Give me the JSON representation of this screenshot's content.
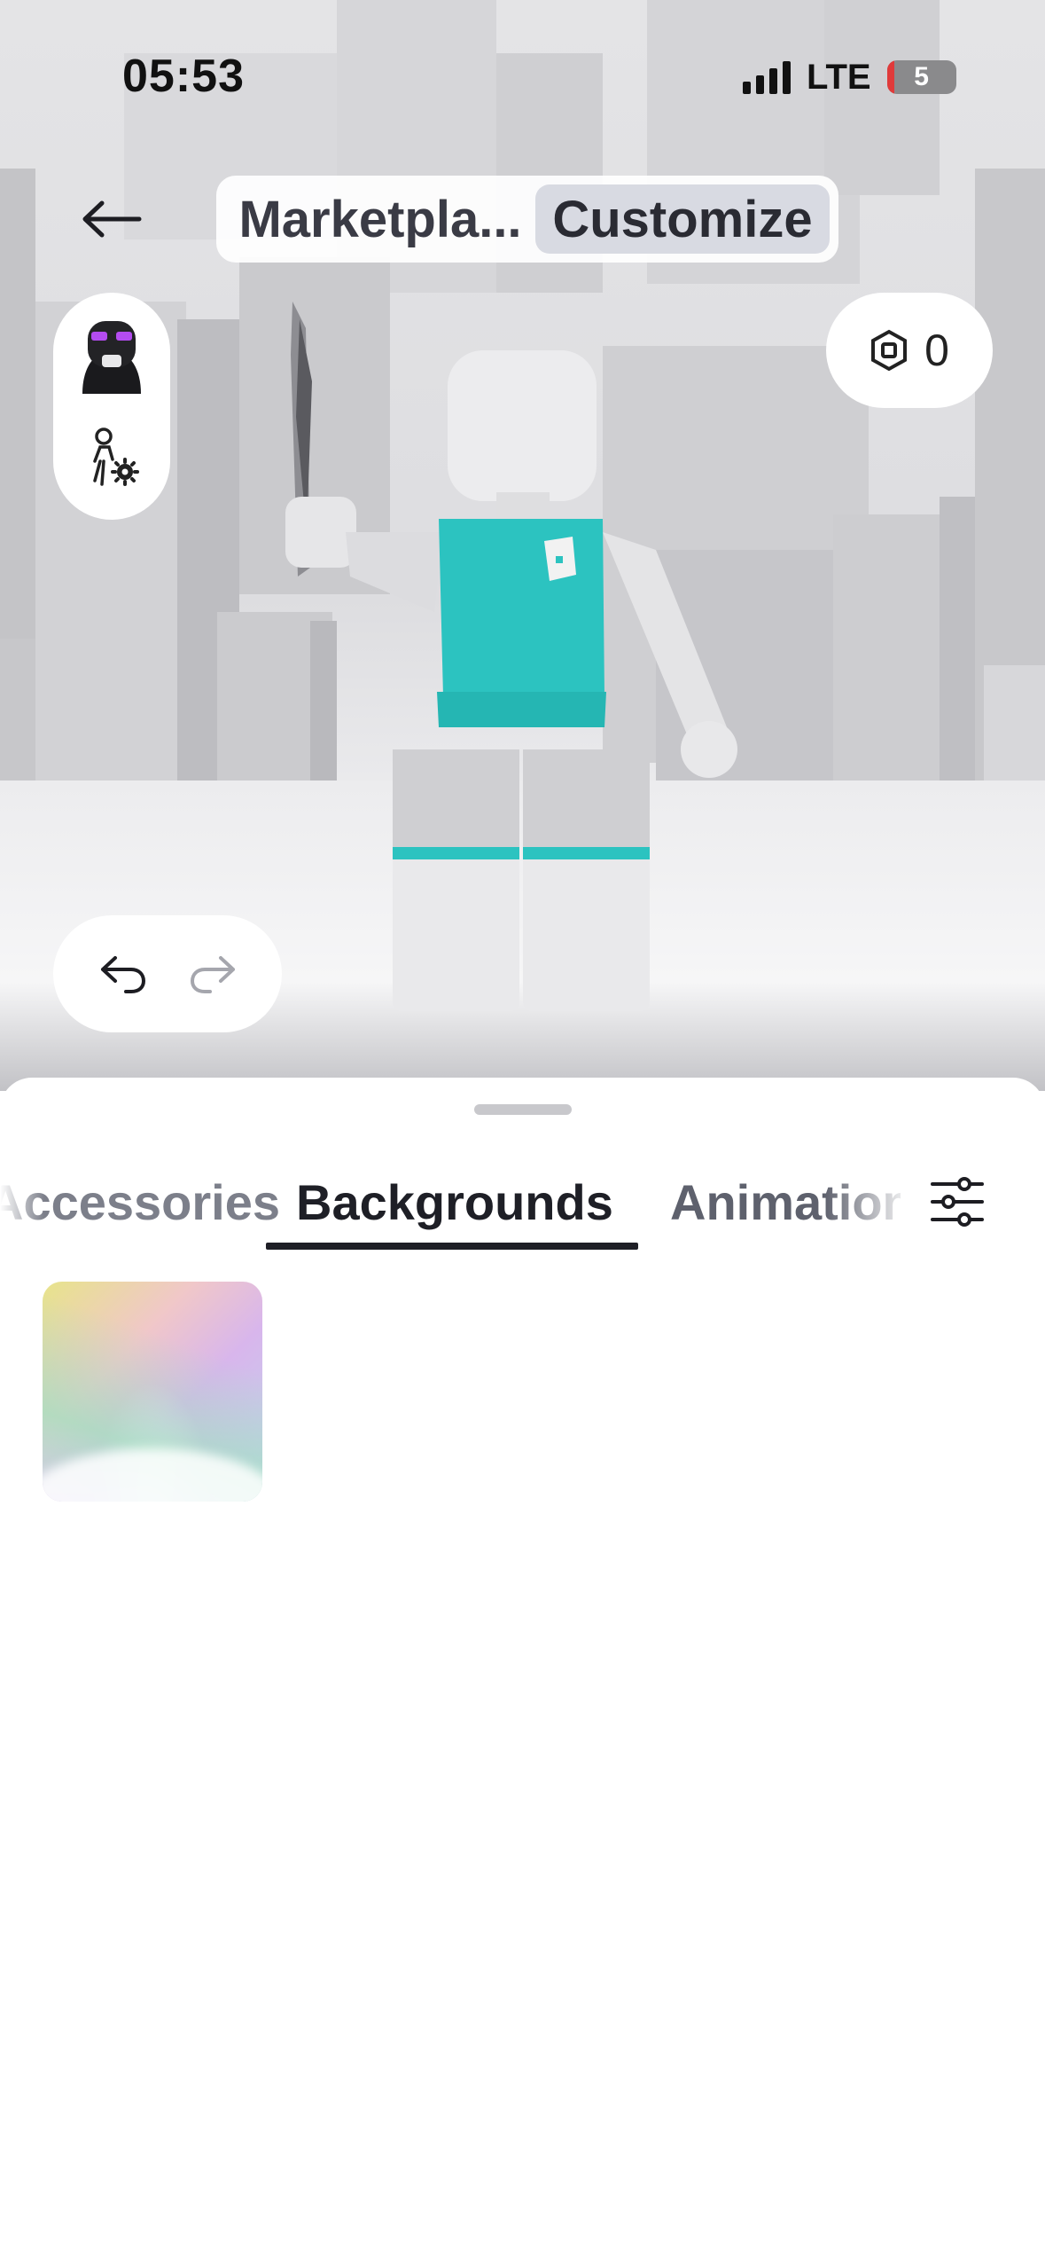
{
  "status_bar": {
    "time": "05:53",
    "network": "LTE",
    "battery": "5"
  },
  "header": {
    "back_icon": "arrow-left-icon",
    "tabs": [
      {
        "label": "Marketpla...",
        "selected": false
      },
      {
        "label": "Customize",
        "selected": true
      }
    ]
  },
  "side_controls": {
    "avatar_icon": "avatar-thumbnail-icon",
    "avatar_settings_icon": "avatar-settings-icon"
  },
  "robux": {
    "icon": "robux-icon",
    "balance": "0"
  },
  "history": {
    "undo_icon": "undo-icon",
    "redo_icon": "redo-icon",
    "redo_enabled": false
  },
  "sheet": {
    "tabs": [
      {
        "label": "Accessories",
        "selected": false
      },
      {
        "label": "Backgrounds",
        "selected": true
      },
      {
        "label": "Animations",
        "selected": false
      }
    ],
    "filter_icon": "filter-sliders-icon",
    "items": [
      {
        "name": "gradient-background-item"
      }
    ]
  },
  "colors": {
    "accent_dark": "#1e1f26",
    "torso": "#2cc3c0"
  }
}
